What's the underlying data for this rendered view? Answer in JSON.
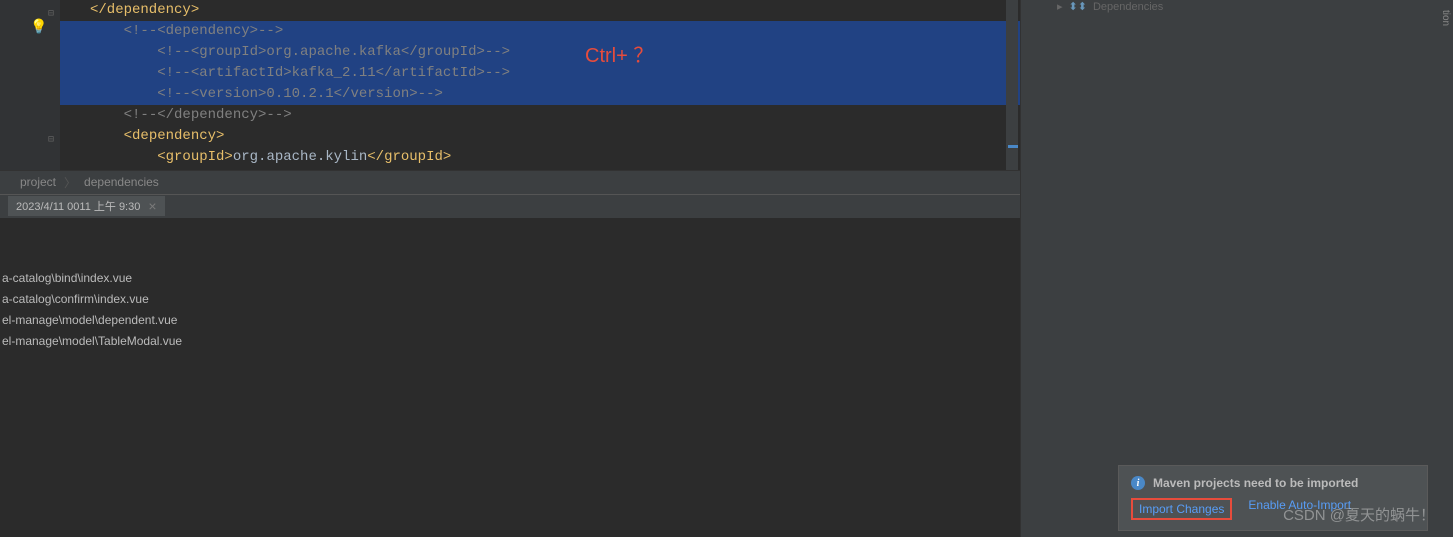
{
  "editor": {
    "overlay_hint": "Ctrl+ ？",
    "lines": {
      "l1_close_dep": "</dependency>",
      "l2_comment_open": "<!--<dependency>-->",
      "l3_groupid": "<!--<groupId>org.apache.kafka</groupId>-->",
      "l4_artifactid": "<!--<artifactId>kafka_2.11</artifactId>-->",
      "l5_version": "<!--<version>0.10.2.1</version>-->",
      "l6_comment_close": "<!--</dependency>-->",
      "l7_dep_open": "<dependency>",
      "l8_groupid_pre": "<groupId>",
      "l8_groupid_val": "org.apache.kylin",
      "l8_groupid_post": "</groupId>"
    }
  },
  "breadcrumb": {
    "item1": "project",
    "item2": "dependencies"
  },
  "console": {
    "tab_label": "2023/4/11 0011 上午 9:30",
    "lines": {
      "f1": "a-catalog\\bind\\index.vue",
      "f2": "a-catalog\\confirm\\index.vue",
      "f3": "el-manage\\model\\dependent.vue",
      "f4": "el-manage\\model\\TableModal.vue"
    }
  },
  "sidebar": {
    "vertical_label": "tion"
  },
  "maven_panel": {
    "tree_node": "Dependencies"
  },
  "notification": {
    "title": "Maven projects need to be imported",
    "link_import": "Import Changes",
    "link_enable": "Enable Auto-Import"
  },
  "watermark": "CSDN @夏天的蜗牛！"
}
